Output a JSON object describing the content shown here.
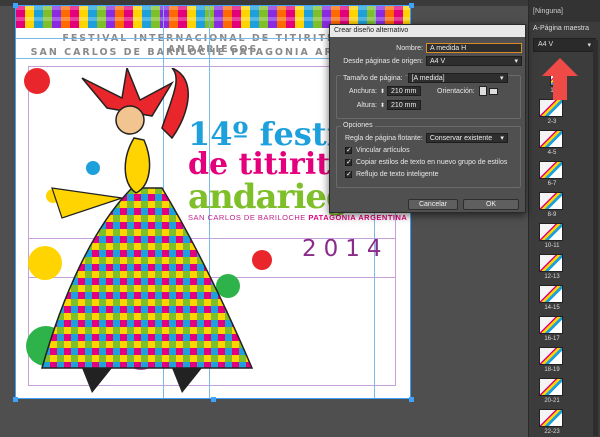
{
  "document": {
    "header_line_1": "FESTIVAL INTERNACIONAL DE TITIRITEROS ANDARIEGOS",
    "header_line_2": "SAN CARLOS DE BARILOCHE PATAGONIA ARGENTINA",
    "title_line_1": "14º festival",
    "title_line_2": "de titiriteros",
    "title_line_3": "andariegos",
    "subtitle_a": "SAN CARLOS DE BARILOCHE",
    "subtitle_b": "PATAGONIA ARGENTINA",
    "year": "2014"
  },
  "pages_panel": {
    "top_label": "[Ninguna]",
    "master_label": "A-Página maestra",
    "size_select": "A4 V",
    "thumbs": [
      {
        "label": "1"
      },
      {
        "label": "2-3"
      },
      {
        "label": "4-5"
      },
      {
        "label": "6-7"
      },
      {
        "label": "8-9"
      },
      {
        "label": "10-11"
      },
      {
        "label": "12-13"
      },
      {
        "label": "14-15"
      },
      {
        "label": "16-17"
      },
      {
        "label": "18-19"
      },
      {
        "label": "20-21"
      },
      {
        "label": "22-23"
      }
    ]
  },
  "dialog": {
    "title": "Crear diseño alternativo",
    "name_label": "Nombre:",
    "name_value": "A medida H",
    "source_label": "Desde páginas de origen:",
    "source_value": "A4 V",
    "page_size_label": "Tamaño de página:",
    "page_size_value": "[A medida]",
    "width_label": "Anchura:",
    "width_value": "210 mm",
    "height_label": "Altura:",
    "height_value": "210 mm",
    "orientation_label": "Orientación:",
    "options_title": "Opciones",
    "liquid_rule_label": "Regla de página flotante:",
    "liquid_rule_value": "Conservar existente",
    "check_link_stories": "Vincular artículos",
    "check_copy_styles": "Copiar estilos de texto en nuevo grupo de estilos",
    "check_smart_reflow": "Reflujo de texto inteligente",
    "cancel_label": "Cancelar",
    "ok_label": "OK"
  },
  "colors": {
    "magenta": "#e4007c",
    "yellow": "#ffd400",
    "cyan": "#1ea0dc",
    "green": "#7fbf2a",
    "purple": "#8a2b8a",
    "red": "#e8262b",
    "selection": "#3ea3ff",
    "arrow": "#f04a46"
  },
  "icons": [
    "arrow-up-icon",
    "checkmark-icon",
    "chevron-down-icon",
    "portrait-orientation-icon",
    "landscape-orientation-icon"
  ]
}
